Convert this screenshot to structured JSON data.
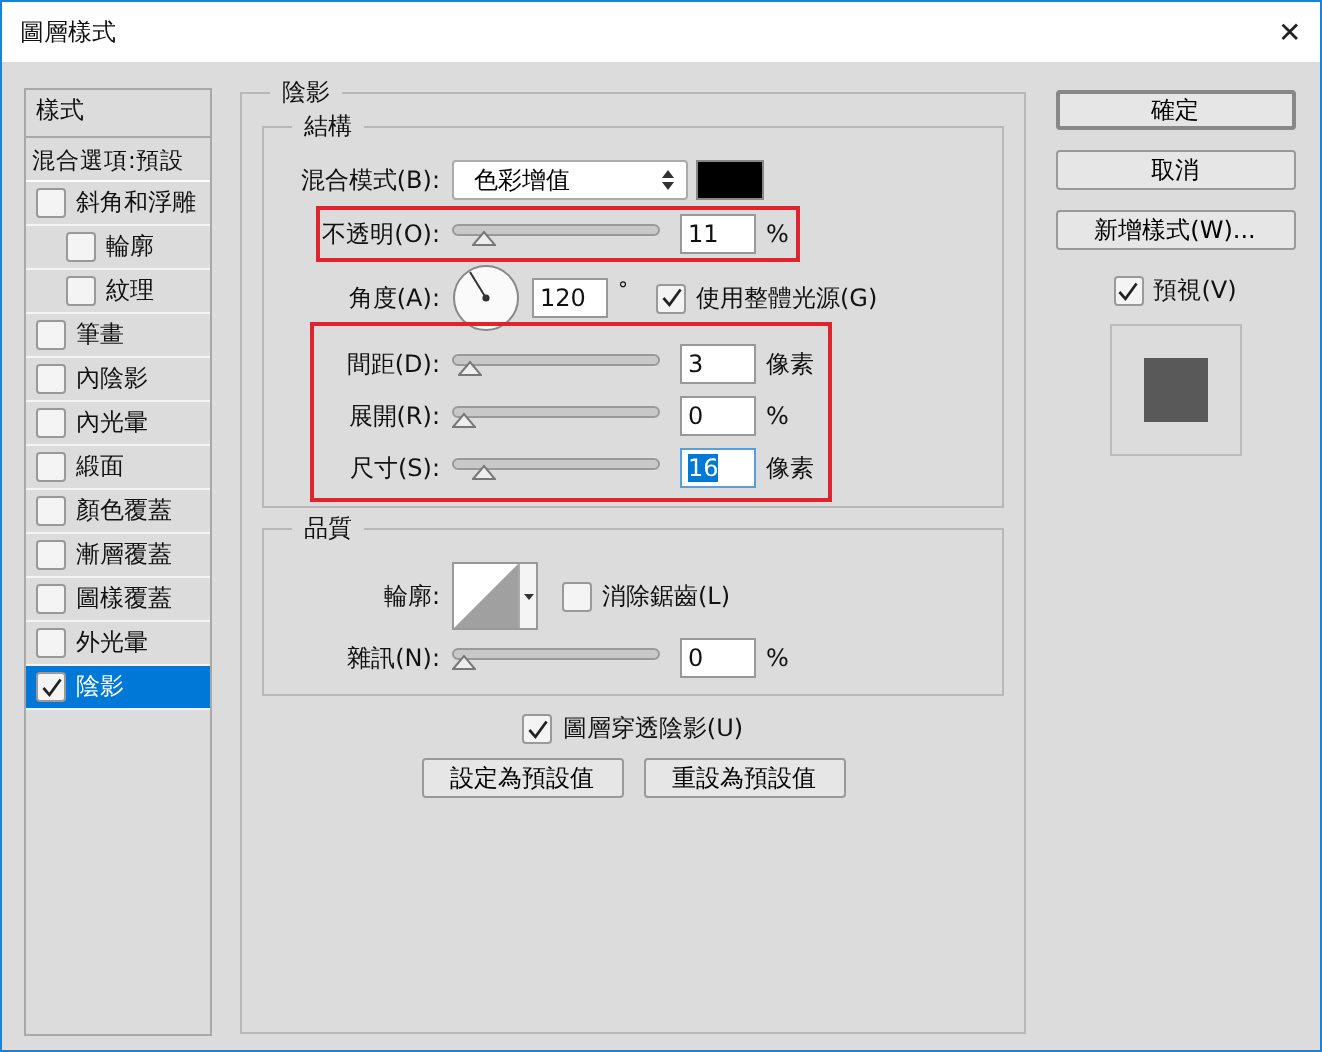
{
  "window": {
    "title": "圖層樣式",
    "close": "✕"
  },
  "sidebar": {
    "header": "樣式",
    "blend_options": "混合選項:預設",
    "items": [
      {
        "label": "斜角和浮雕",
        "checked": false,
        "selected": false,
        "children": [
          {
            "label": "輪廓",
            "checked": false,
            "selected": false
          },
          {
            "label": "紋理",
            "checked": false,
            "selected": false
          }
        ]
      },
      {
        "label": "筆畫",
        "checked": false,
        "selected": false
      },
      {
        "label": "內陰影",
        "checked": false,
        "selected": false
      },
      {
        "label": "內光暈",
        "checked": false,
        "selected": false
      },
      {
        "label": "緞面",
        "checked": false,
        "selected": false
      },
      {
        "label": "顏色覆蓋",
        "checked": false,
        "selected": false
      },
      {
        "label": "漸層覆蓋",
        "checked": false,
        "selected": false
      },
      {
        "label": "圖樣覆蓋",
        "checked": false,
        "selected": false
      },
      {
        "label": "外光暈",
        "checked": false,
        "selected": false
      },
      {
        "label": "陰影",
        "checked": true,
        "selected": true
      }
    ]
  },
  "panel": {
    "title": "陰影",
    "structure": {
      "title": "結構",
      "blend_mode": {
        "label": "混合模式(B):",
        "value": "色彩增值",
        "color": "#000000"
      },
      "opacity": {
        "label": "不透明(O):",
        "level": 0.11,
        "value": "11",
        "unit": "%",
        "highlighted": true
      },
      "angle": {
        "label": "角度(A):",
        "value": "120",
        "unit": "°",
        "global_light": {
          "label": "使用整體光源(G)",
          "checked": true
        }
      },
      "params": {
        "highlighted": true,
        "rows": [
          {
            "label": "間距(D):",
            "level": 0.03,
            "value": "3",
            "unit": "像素",
            "focused": false
          },
          {
            "label": "展開(R):",
            "level": 0,
            "value": "0",
            "unit": "%",
            "focused": false
          },
          {
            "label": "尺寸(S):",
            "level": 0.11,
            "value": "16",
            "unit": "像素",
            "focused": true
          }
        ]
      }
    },
    "quality": {
      "title": "品質",
      "contour": {
        "label": "輪廓:",
        "anti_alias": {
          "label": "消除鋸齒(L)",
          "checked": false
        }
      },
      "noise": {
        "label": "雜訊(N):",
        "level": 0,
        "value": "0",
        "unit": "%"
      }
    },
    "knockout": {
      "label": "圖層穿透陰影(U)",
      "checked": true
    },
    "buttons": [
      "設定為預設值",
      "重設為預設值"
    ]
  },
  "actions": {
    "buttons": [
      {
        "label": "確定",
        "default": true
      },
      {
        "label": "取消",
        "default": false
      },
      {
        "label": "新增樣式(W)...",
        "default": false
      }
    ],
    "preview": {
      "label": "預視(V)",
      "checked": true
    }
  }
}
